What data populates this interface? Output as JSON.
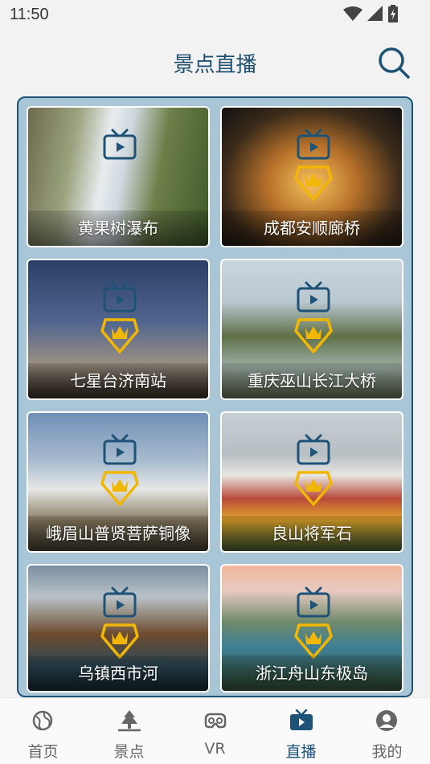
{
  "status_bar": {
    "time": "11:50"
  },
  "header": {
    "title": "景点直播"
  },
  "spots": [
    {
      "name": "黄果树瀑布"
    },
    {
      "name": "成都安顺廊桥"
    },
    {
      "name": "七星台济南站"
    },
    {
      "name": "重庆巫山长江大桥"
    },
    {
      "name": "峨眉山普贤菩萨铜像"
    },
    {
      "name": "良山将军石"
    },
    {
      "name": "乌镇西市河"
    },
    {
      "name": "浙江舟山东极岛"
    }
  ],
  "tabs": [
    {
      "label": "首页",
      "icon": "globe-icon"
    },
    {
      "label": "景点",
      "icon": "tree-icon"
    },
    {
      "label": "VR",
      "icon": "vr-icon"
    },
    {
      "label": "直播",
      "icon": "tv-icon",
      "active": true
    },
    {
      "label": "我的",
      "icon": "user-icon"
    }
  ],
  "colors": {
    "primary": "#1e5277",
    "panel": "#a8c6d6",
    "gold": "#f2b705"
  }
}
